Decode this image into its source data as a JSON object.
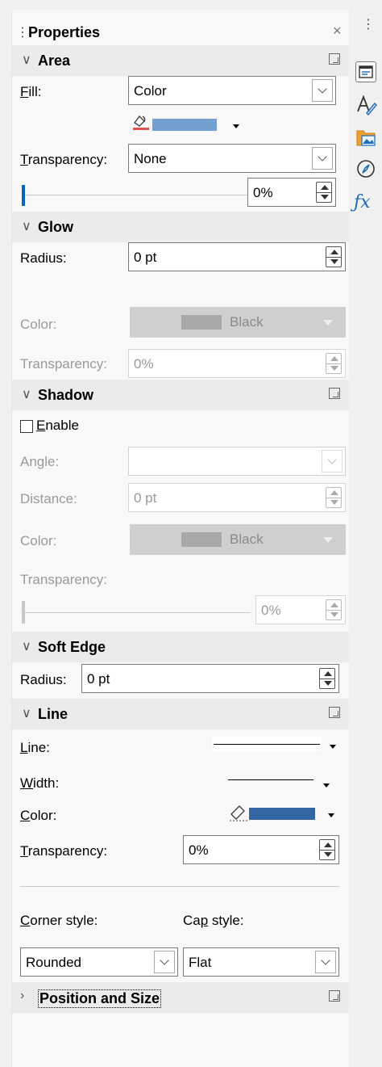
{
  "panel": {
    "title": "Properties"
  },
  "area": {
    "title": "Area",
    "fill_label": "Fill:",
    "fill_value": "Color",
    "fill_color": "#729fcf",
    "transparency_label": "Transparency:",
    "transparency_value": "None",
    "transparency_percent": "0%"
  },
  "glow": {
    "title": "Glow",
    "radius_label": "Radius:",
    "radius_value": "0 pt",
    "color_label": "Color:",
    "color_name": "Black",
    "transparency_label": "Transparency:",
    "transparency_value": "0%"
  },
  "shadow": {
    "title": "Shadow",
    "enable_label": "Enable",
    "angle_label": "Angle:",
    "angle_value": "",
    "distance_label": "Distance:",
    "distance_value": "0 pt",
    "color_label": "Color:",
    "color_name": "Black",
    "transparency_label": "Transparency:",
    "transparency_percent": "0%"
  },
  "soft_edge": {
    "title": "Soft Edge",
    "radius_label": "Radius:",
    "radius_value": "0 pt"
  },
  "line": {
    "title": "Line",
    "line_label": "Line:",
    "width_label": "Width:",
    "color_label": "Color:",
    "line_color": "#3465a4",
    "transparency_label": "Transparency:",
    "transparency_value": "0%",
    "corner_label": "Corner style:",
    "corner_value": "Rounded",
    "cap_label": "Cap style:",
    "cap_value": "Flat"
  },
  "position_size": {
    "title": "Position and Size"
  },
  "colors": {
    "accent": "#0067c0"
  }
}
